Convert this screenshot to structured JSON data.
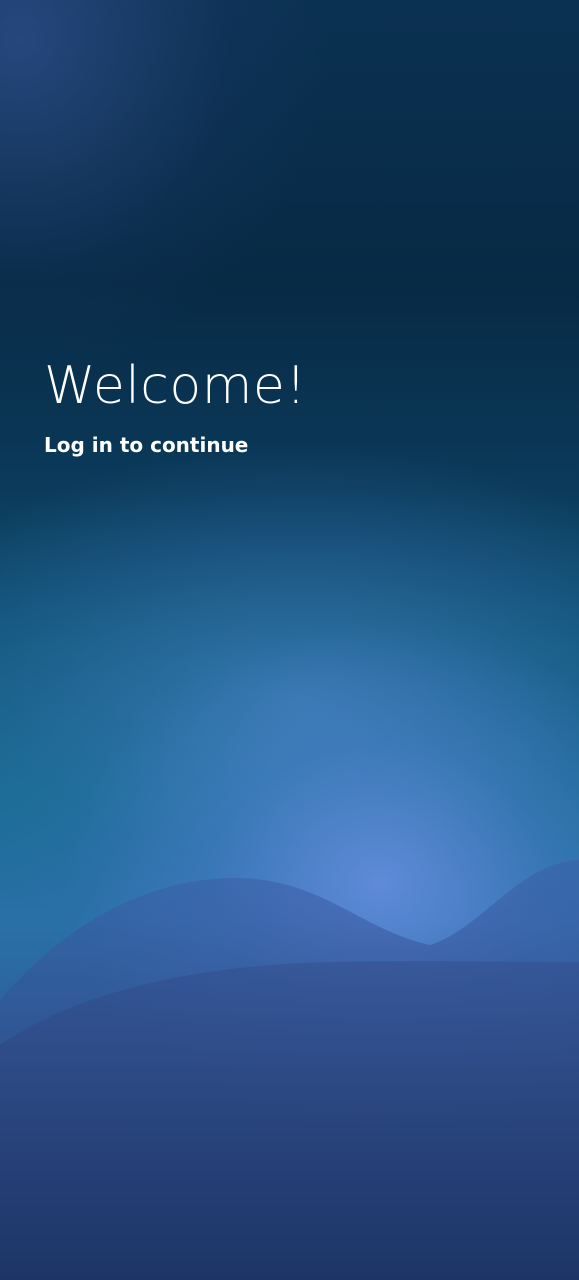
{
  "welcome": {
    "title": "Welcome!",
    "subtitle": "Log in to continue"
  },
  "colors": {
    "background_top": "#072a45",
    "background_mid": "#176a8f",
    "background_bottom": "#1f3a6a",
    "glow": "#8ca0ff",
    "text": "#ffffff"
  }
}
